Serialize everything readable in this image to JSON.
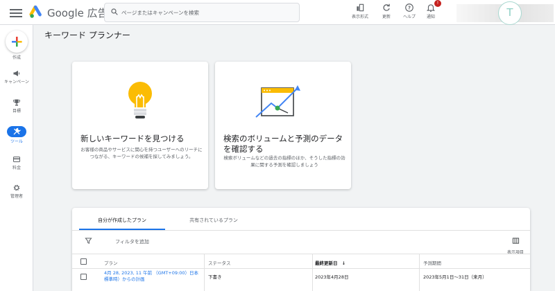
{
  "header": {
    "brand": "Google 広告",
    "search_placeholder": "ページまたはキャンペーンを検索",
    "buttons": [
      {
        "label": "表示形式",
        "icon": "view-mode-icon"
      },
      {
        "label": "更新",
        "icon": "refresh-icon"
      },
      {
        "label": "ヘルプ",
        "icon": "help-icon"
      },
      {
        "label": "通知",
        "icon": "bell-icon",
        "badge": "!"
      }
    ],
    "avatar_letter": "T"
  },
  "sidebar": {
    "create_label": "作成",
    "items": [
      {
        "label": "キャンペーン",
        "icon": "megaphone-icon"
      },
      {
        "label": "目標",
        "icon": "trophy-icon"
      },
      {
        "label": "ツール",
        "icon": "tools-icon",
        "active": true
      },
      {
        "label": "料金",
        "icon": "billing-icon"
      },
      {
        "label": "管理者",
        "icon": "gear-icon"
      }
    ]
  },
  "page": {
    "title": "キーワード プランナー"
  },
  "cards": [
    {
      "title": "新しいキーワードを見つける",
      "description": "お客様の商品やサービスに関心を持つユーザーへのリーチにつながる、キーワードの候補を探してみましょう。",
      "icon": "lightbulb-icon"
    },
    {
      "title": "検索のボリュームと予測のデータを確認する",
      "description": "検索ボリュームなどの過去の指標のほか、そうした指標の効果に関する予測を確認しましょう",
      "icon": "trend-chart-icon"
    }
  ],
  "plans": {
    "tabs": [
      {
        "label": "自分が作成したプラン",
        "active": true
      },
      {
        "label": "共有されているプラン",
        "active": false
      }
    ],
    "filter_label": "フィルタを追加",
    "columns_label": "表示項目",
    "columns": [
      "プラン",
      "ステータス",
      "最終更新日",
      "予測期間"
    ],
    "sort_indicator": "↓",
    "rows": [
      {
        "plan": "4月 28, 2023, 11 午前 （GMT+09:00）日本標準時）からの計画",
        "status": "下書き",
        "updated": "2023年4月28日",
        "period": "2023年5月1日～31日（来月）"
      }
    ]
  },
  "colors": {
    "accent": "#1a73e8",
    "notification": "#c5221f"
  }
}
